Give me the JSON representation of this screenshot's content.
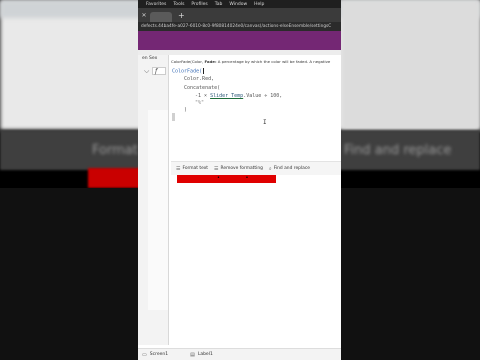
{
  "browser": {
    "menu": [
      "Favorites",
      "Tools",
      "Profiles",
      "Tab",
      "Window",
      "Help"
    ],
    "url": "defects.44ba4fe-a027-6010-8c0-9f80814024e0/canvas(/actions-elseEnsemble/settingsC"
  },
  "sidebar": {
    "screen_label": "en Sex",
    "fx_label": "f"
  },
  "formula_tooltip": {
    "function": "ColorFade(",
    "param": "Color,",
    "param_bold": "Fade:",
    "desc": "A percentage by which the color will be faded. A negative"
  },
  "editor": {
    "lines": [
      "ColorFade(",
      "Color.Red,",
      "Concatenate(",
      "-1 × Slider_Temp.Value ÷ 100,",
      "\"%\"",
      ")"
    ],
    "control_name": "Slider_Temp"
  },
  "format_bar": {
    "format_text": "Format text",
    "remove_formatting": "Remove formatting",
    "find_replace": "Find and replace"
  },
  "background": {
    "ghost_left": "Format",
    "ghost_right": "Find and replace"
  },
  "footer": {
    "screen": "Screen1",
    "label": "Label1"
  },
  "colors": {
    "accent_purple": "#742774",
    "fill_red": "#e00000"
  }
}
